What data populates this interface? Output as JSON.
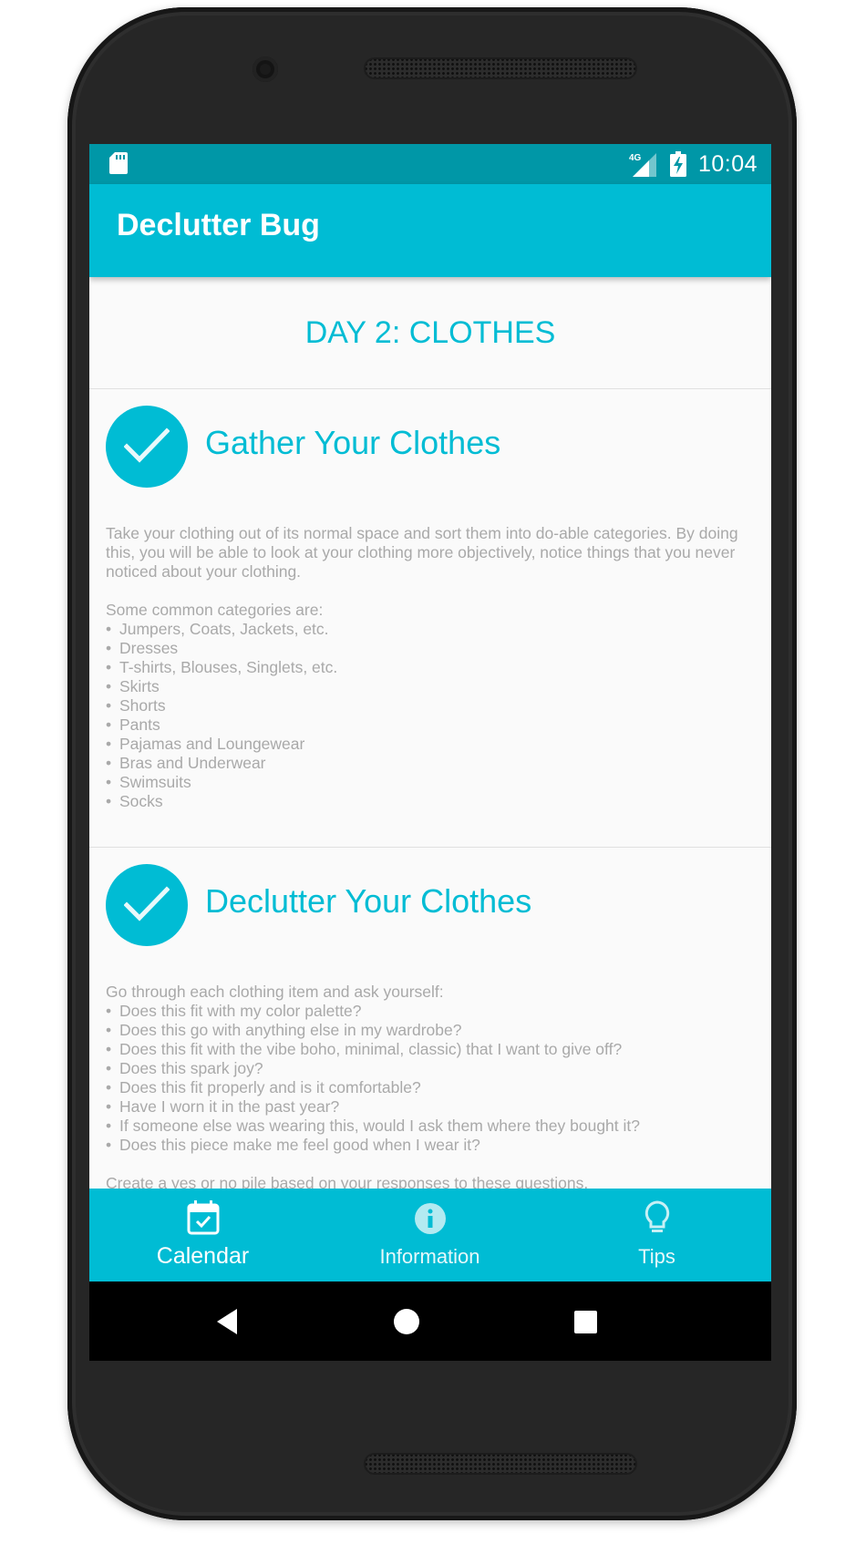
{
  "status_bar": {
    "time": "10:04",
    "network": "4G",
    "icons": [
      "sd-card-icon",
      "signal-icon",
      "battery-charging-icon"
    ]
  },
  "app_bar": {
    "title": "Declutter Bug"
  },
  "day": {
    "title": "DAY 2: CLOTHES"
  },
  "sections": [
    {
      "title": "Gather Your Clothes",
      "completed": true,
      "intro": "Take your clothing out of its normal space and sort them into do-able categories. By doing this, you will be able to look at your clothing more objectively, notice things that you never noticed about your clothing.",
      "list_heading": "Some common categories are:",
      "items": [
        "Jumpers, Coats, Jackets, etc.",
        "Dresses",
        " T-shirts, Blouses, Singlets, etc.",
        "Skirts",
        "Shorts",
        "Pants",
        "Pajamas and Loungewear",
        "Bras and Underwear",
        "Swimsuits",
        "Socks"
      ]
    },
    {
      "title": "Declutter Your Clothes",
      "completed": true,
      "list_heading": "Go through each clothing item and ask yourself:",
      "items": [
        "Does this fit with my color palette?",
        "Does this go with anything else in my wardrobe?",
        "Does this fit with the vibe boho, minimal, classic) that I want to give off?",
        "Does this spark joy?",
        "Does this fit properly and is it comfortable?",
        "Have I worn it in the past year?",
        "If someone else was wearing this, would I ask them where they bought it?",
        "Does this piece make me feel good when I wear it?"
      ],
      "outro": "Create a yes or no pile based on your responses to these questions."
    }
  ],
  "bottom_nav": {
    "items": [
      {
        "label": "Calendar",
        "icon": "calendar-icon",
        "active": true
      },
      {
        "label": "Information",
        "icon": "info-icon",
        "active": false
      },
      {
        "label": "Tips",
        "icon": "lightbulb-icon",
        "active": false
      }
    ]
  },
  "system_nav": {
    "buttons": [
      "back-icon",
      "home-icon",
      "recents-icon"
    ]
  },
  "colors": {
    "primary": "#00bcd4",
    "primary_dark": "#0097a7",
    "body_text": "#a9a9a9",
    "background": "#fafafa"
  }
}
